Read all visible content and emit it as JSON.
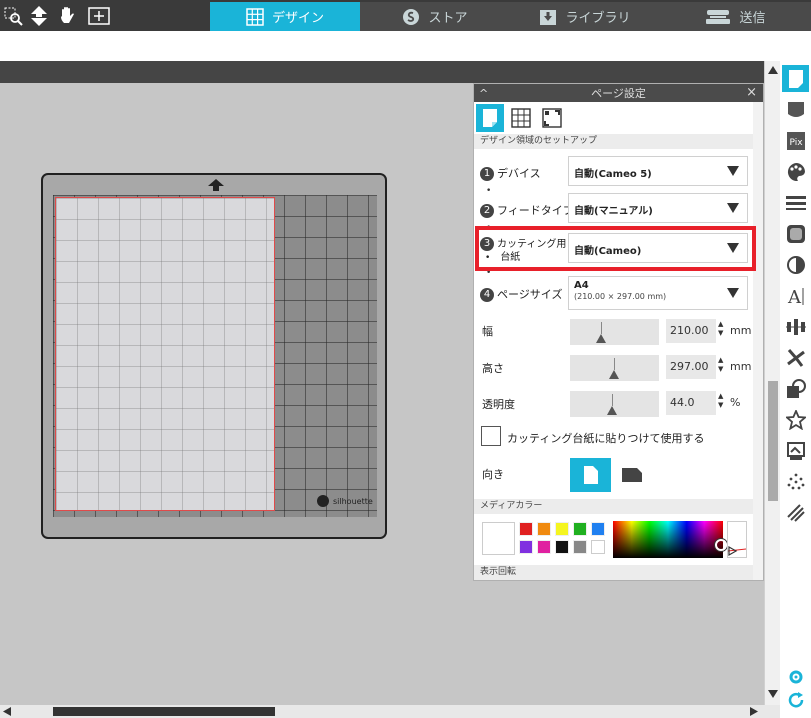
{
  "toolbar": {
    "icons": [
      "zoom-select-icon",
      "move-icon",
      "pan-hand-icon",
      "fit-page-icon"
    ]
  },
  "tabs": [
    {
      "label": "デザイン",
      "icon": "grid-icon",
      "active": true
    },
    {
      "label": "ストア",
      "icon": "store-icon",
      "active": false
    },
    {
      "label": "ライブラリ",
      "icon": "library-icon",
      "active": false
    },
    {
      "label": "送信",
      "icon": "send-icon",
      "active": false
    }
  ],
  "mat": {
    "brand": "silhouette"
  },
  "panel": {
    "title": "ページ設定",
    "collapse_glyph": "^",
    "close_glyph": "×",
    "section_setup": "デザイン領域のセットアップ",
    "rows": [
      {
        "num": "1",
        "label": "デバイス",
        "value": "自動(Cameo 5)"
      },
      {
        "num": "2",
        "label": "フィードタイプ",
        "value": "自動(マニュアル)"
      },
      {
        "num": "3",
        "label": "カッティング用",
        "label2": "台紙",
        "value": "自動(Cameo)"
      },
      {
        "num": "4",
        "label": "ページサイズ",
        "value": "A4",
        "sub": "(210.00 × 297.00 mm)"
      }
    ],
    "width_label": "幅",
    "width_value": "210.00",
    "width_unit": "mm",
    "height_label": "高さ",
    "height_value": "297.00",
    "height_unit": "mm",
    "opacity_label": "透明度",
    "opacity_value": "44.0",
    "opacity_unit": "%",
    "stick_label": "カッティング台紙に貼りつけて使用する",
    "orientation_label": "向き",
    "section_media": "メディアカラー",
    "section_rotate": "表示回転"
  },
  "colors": {
    "accent": "#1ab4d8",
    "highlight": "#e8202a",
    "swatches": [
      "#e02020",
      "#f08a10",
      "#f5f520",
      "#20b020",
      "#2080f0",
      "#8030e0",
      "#e020a0",
      "#111111",
      "#888888",
      "#ffffff"
    ]
  },
  "sidebar": {
    "items": [
      "page-setup-icon",
      "cut-settings-icon",
      "pixscan-icon",
      "fill-icon",
      "line-style-icon",
      "offset-icon",
      "trace-icon",
      "text-icon",
      "align-icon",
      "replicate-icon",
      "modify-icon",
      "library-star-icon",
      "transform-icon",
      "sketch-icon",
      "stipple-icon",
      "settings-icon",
      "refresh-icon"
    ]
  }
}
